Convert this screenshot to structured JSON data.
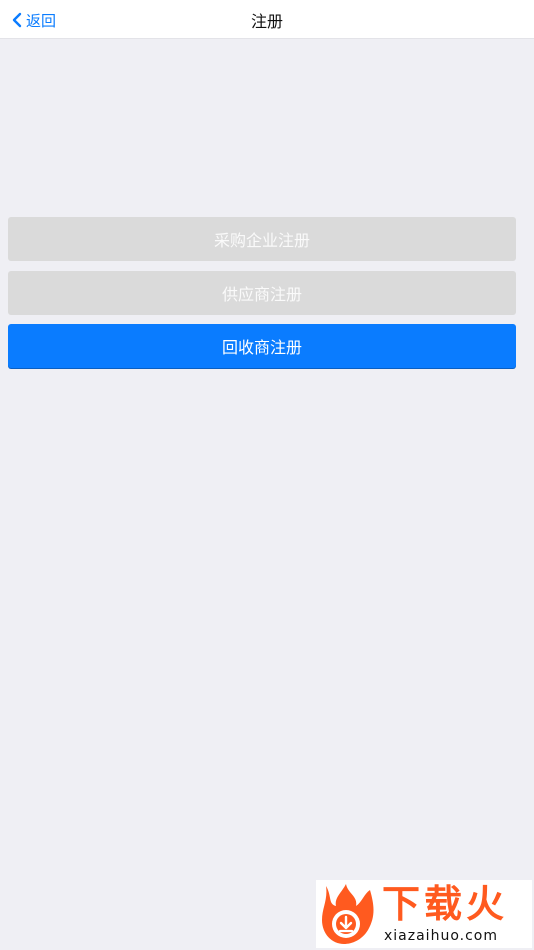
{
  "navbar": {
    "back_label": "返回",
    "title": "注册",
    "back_icon": "chevron-left-icon"
  },
  "buttons": [
    {
      "label": "采购企业注册",
      "state": "disabled"
    },
    {
      "label": "供应商注册",
      "state": "disabled"
    },
    {
      "label": "回收商注册",
      "state": "active"
    }
  ],
  "watermark": {
    "text": "下载火",
    "url": "xiazaihuo.com",
    "icon": "flame-download-logo"
  },
  "colors": {
    "accent": "#0a7cff",
    "background": "#efeff4",
    "disabled_button": "#dadada",
    "watermark_orange": "#ff5a1f"
  }
}
